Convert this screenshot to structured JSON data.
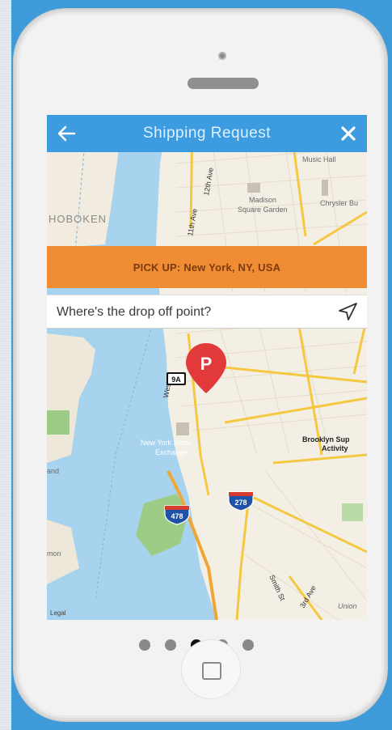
{
  "header": {
    "title": "Shipping Request",
    "back_icon": "arrow-left-icon",
    "close_icon": "close-icon"
  },
  "pickup": {
    "label": "PICK UP: New York, NY, USA"
  },
  "dropoff": {
    "placeholder": "Where's the drop off point?",
    "locate_icon": "navigation-arrow-icon"
  },
  "map": {
    "labels": {
      "hoboken": "HOBOKEN",
      "music_hall": "Music Hall",
      "madison_1": "Madison",
      "madison_2": "Square Garden",
      "chrysler": "Chrysler Bu",
      "nyse_1": "New York Stock",
      "nyse_2": "Exchange",
      "brooklyn_1": "Brooklyn Sup",
      "brooklyn_2": "Activity",
      "west_st": "West St",
      "ave_11": "11th Ave",
      "ave_12": "12th Ave",
      "smith_st": "Smith St",
      "third_ave": "3rd Ave",
      "union": "Union",
      "and": "and",
      "mon": "mon",
      "legal": "Legal"
    },
    "shields": {
      "r9a": "9A",
      "i478": "478",
      "i278": "278"
    },
    "marker_letter": "P"
  },
  "pager": {
    "total": 5,
    "active_index": 2
  },
  "colors": {
    "header_bg": "#3d9ce0",
    "pickup_bg": "#f08c33",
    "marker": "#e23a3a",
    "water": "#a8d3ef",
    "land": "#f4efe4"
  }
}
